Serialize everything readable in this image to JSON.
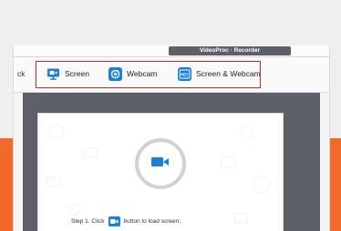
{
  "window": {
    "title": "VideoProc · Recorder"
  },
  "toolbar": {
    "back_fragment": "ck",
    "modes": [
      {
        "label": "Screen",
        "icon": "monitor-camera-icon"
      },
      {
        "label": "Webcam",
        "icon": "webcam-icon"
      },
      {
        "label": "Screen & Webcam",
        "icon": "rec-icon"
      }
    ]
  },
  "main": {
    "record_icon": "video-camera-icon",
    "step1": {
      "prefix": "Step 1. Click",
      "suffix": "button to load screen;"
    }
  },
  "colors": {
    "accent": "#1a7fd8",
    "highlight": "#e0222b",
    "brand_orange": "#f26a2b",
    "content_bg": "#5d6069"
  }
}
